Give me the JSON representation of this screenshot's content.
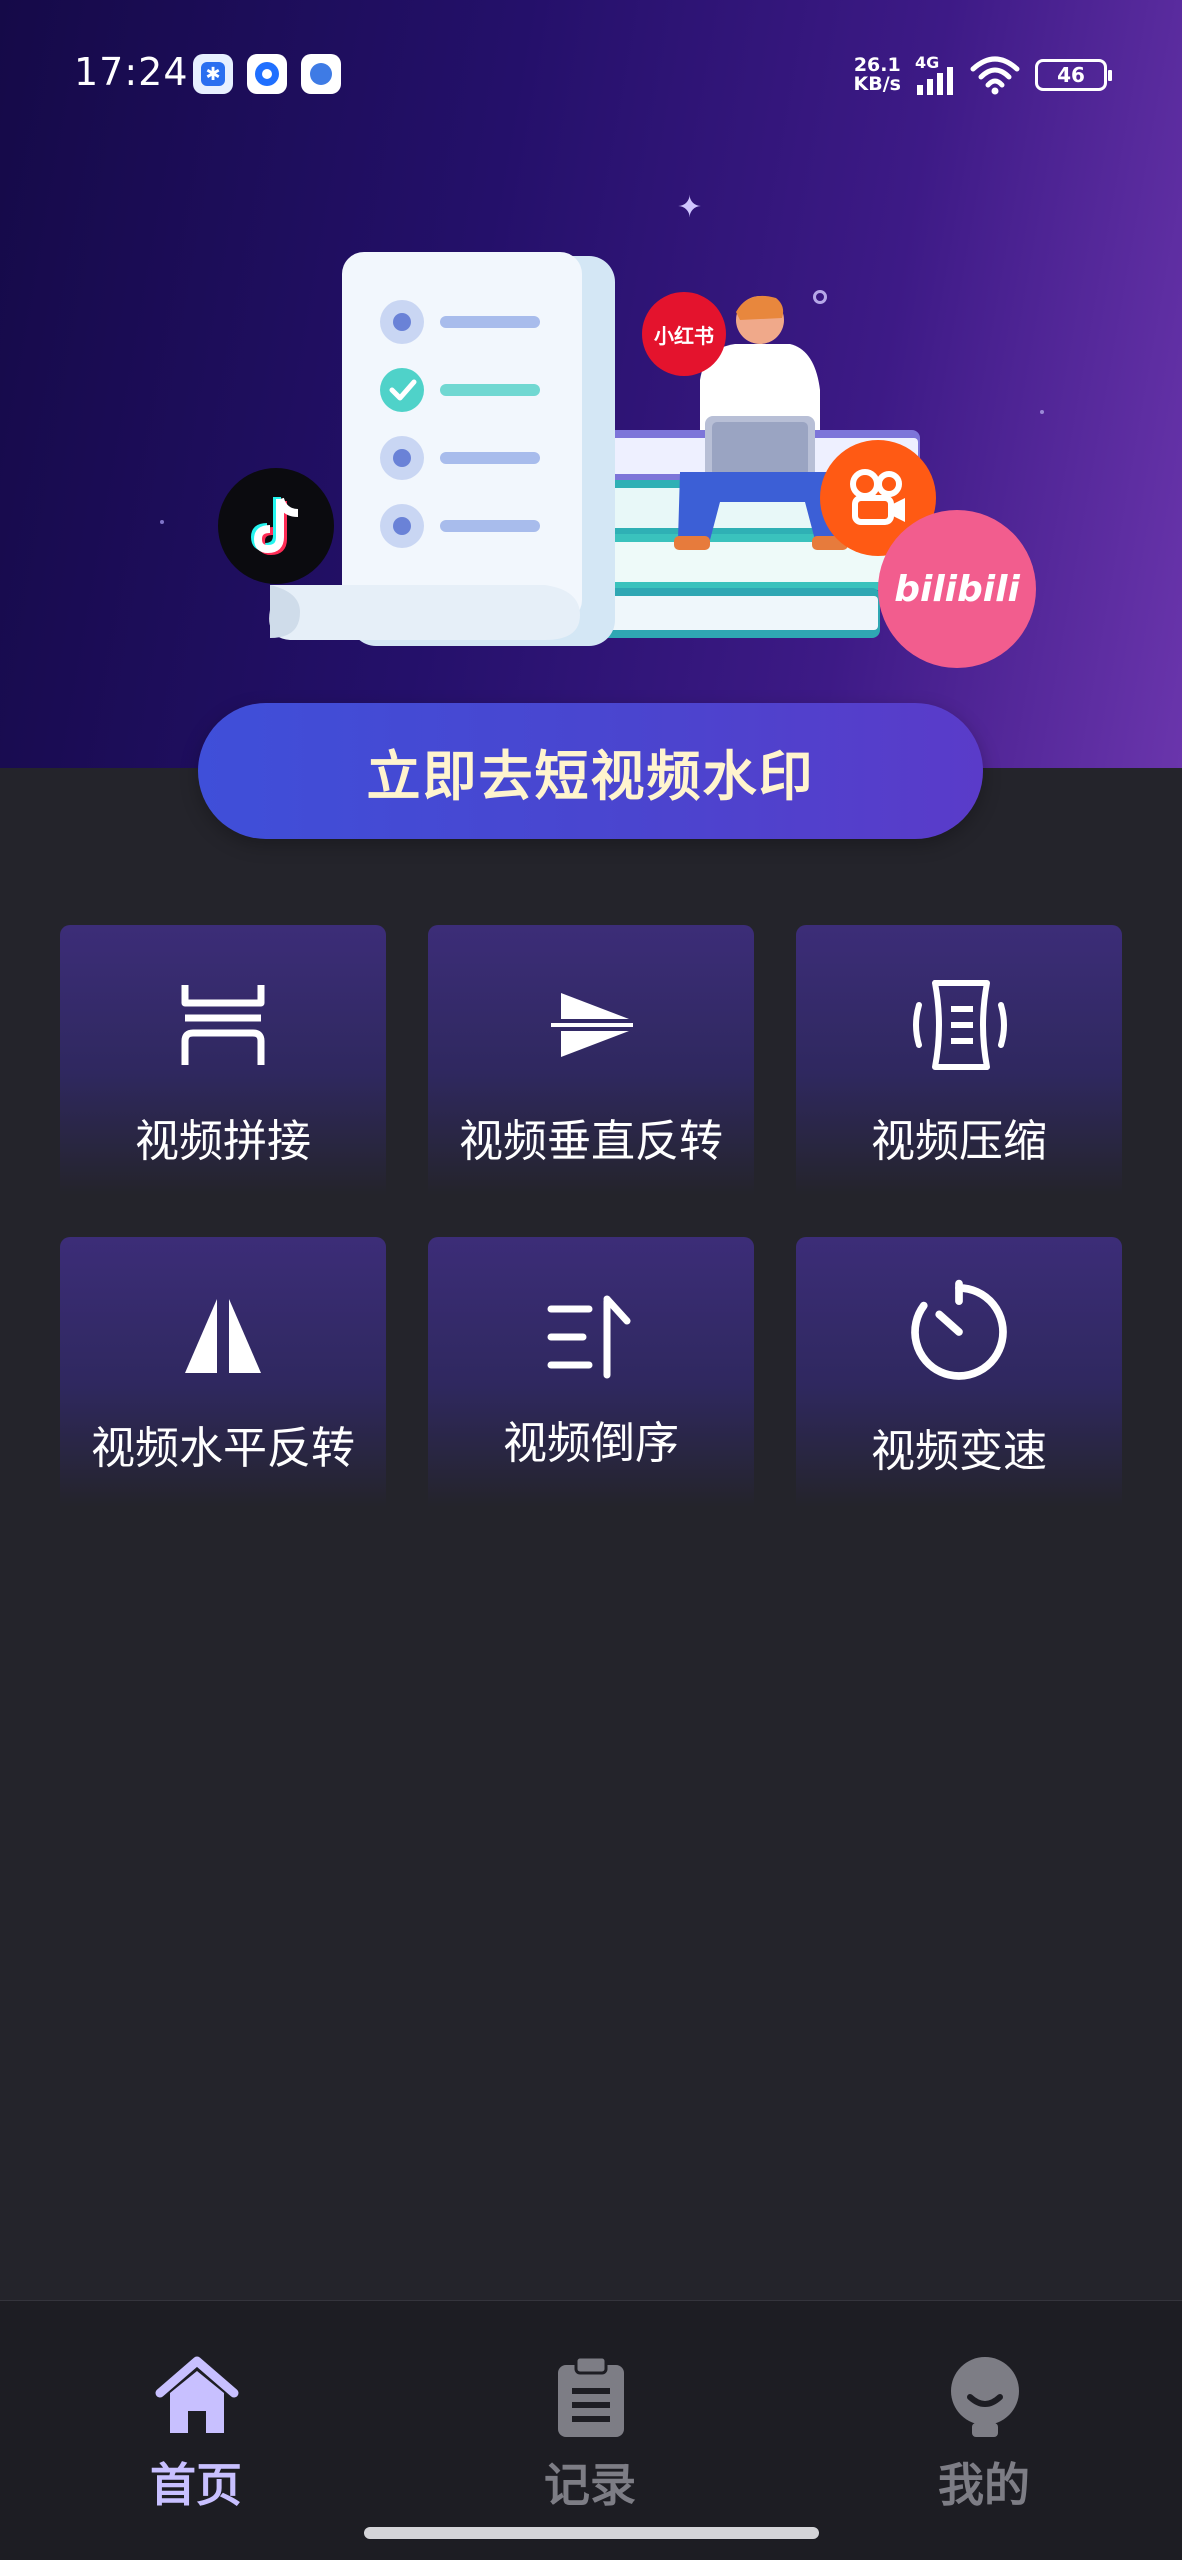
{
  "status_bar": {
    "time": "17:24",
    "network_speed_value": "26.1",
    "network_speed_unit": "KB/s",
    "network_type": "4G",
    "battery_level": "46",
    "app_icons": [
      "notification-app-icon",
      "notification-app-icon",
      "notification-app-icon"
    ]
  },
  "banner": {
    "platform_badges": {
      "xiaohongshu": "小红书",
      "bilibili": "bilibili"
    },
    "primary_action_label": "立即去短视频水印"
  },
  "tools": [
    {
      "label": "视频拼接",
      "icon": "video-splice-icon"
    },
    {
      "label": "视频垂直反转",
      "icon": "vertical-flip-icon"
    },
    {
      "label": "视频压缩",
      "icon": "compress-icon"
    },
    {
      "label": "视频水平反转",
      "icon": "horizontal-flip-icon"
    },
    {
      "label": "视频倒序",
      "icon": "reverse-order-icon"
    },
    {
      "label": "视频变速",
      "icon": "speed-timer-icon"
    }
  ],
  "bottom_nav": {
    "items": [
      {
        "label": "首页",
        "icon": "home-icon",
        "active": true
      },
      {
        "label": "记录",
        "icon": "clipboard-icon",
        "active": false
      },
      {
        "label": "我的",
        "icon": "profile-icon",
        "active": false
      }
    ],
    "active_color": "#c8c0ff",
    "inactive_color": "#7d7d85"
  },
  "colors": {
    "background": "#24242b",
    "button_text": "#fff4ce",
    "tile_top": "#3c2d78"
  }
}
